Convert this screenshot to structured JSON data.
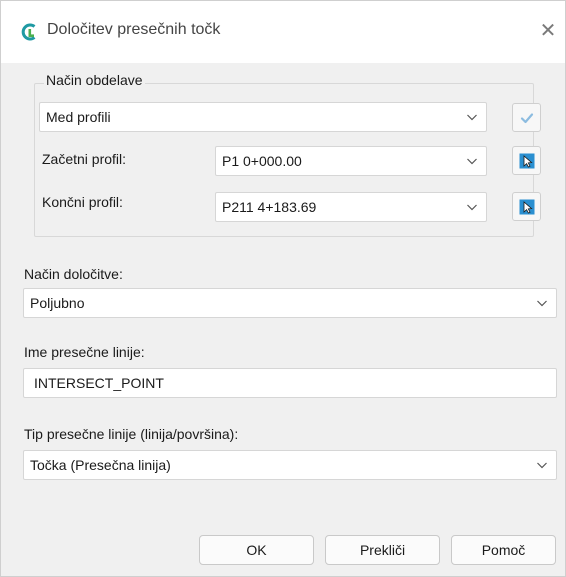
{
  "window": {
    "title": "Določitev presečnih točk",
    "close_glyph": "✕",
    "logo_icon": "civil-app-logo-icon"
  },
  "group": {
    "legend": "Način obdelave",
    "method_select": "Med profili",
    "start_label": "Začetni profil:",
    "start_value": "P1 0+000.00",
    "end_label": "Končni profil:",
    "end_value": "P211 4+183.69",
    "apply_icon": "checkmark-icon",
    "pick_icon": "pick-cursor-icon"
  },
  "determination": {
    "label": "Način določitve:",
    "value": "Poljubno"
  },
  "line_name": {
    "label": "Ime presečne linije:",
    "value": "INTERSECT_POINT"
  },
  "line_type": {
    "label": "Tip presečne linije (linija/površina):",
    "value": "Točka (Presečna linija)"
  },
  "buttons": {
    "ok": "OK",
    "cancel": "Prekliči",
    "help": "Pomoč"
  },
  "colors": {
    "accent": "#2a8fd0",
    "logo_teal": "#1f9aa3",
    "logo_green": "#4caf50",
    "dialog_bg": "#f0f0f0"
  }
}
